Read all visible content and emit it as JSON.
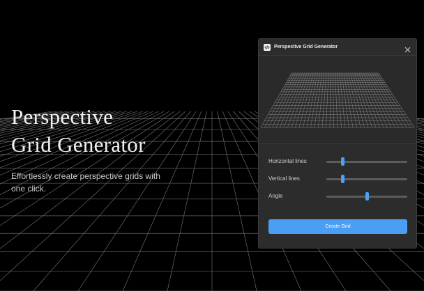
{
  "hero": {
    "title_line1": "Perspective",
    "title_line2": "Grid Generator",
    "subtitle": "Effortlessly create perspective grids with one click."
  },
  "panel": {
    "icon": "code-icon",
    "title": "Perspective Grid Generator",
    "close_icon": "close-icon"
  },
  "controls": [
    {
      "label": "Horizontal lines",
      "value": 0.2
    },
    {
      "label": "Vertical lines",
      "value": 0.2
    },
    {
      "label": "Angle",
      "value": 0.5
    }
  ],
  "button": {
    "label": "Create Grid"
  },
  "colors": {
    "accent": "#4a9ff5",
    "background": "#000000",
    "panel": "#2c2c2c"
  }
}
